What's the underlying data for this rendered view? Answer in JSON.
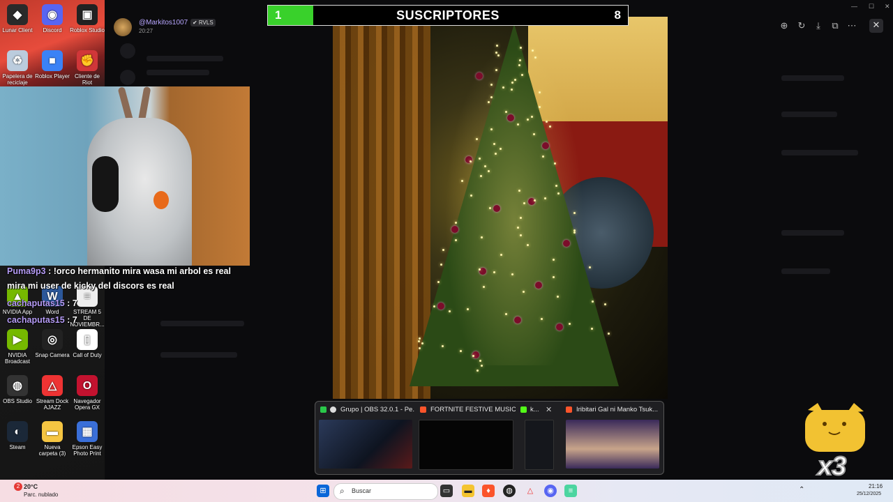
{
  "desktop_icons": [
    {
      "label": "Lunar Client",
      "glyph": "◆",
      "color": "#2a2a2a"
    },
    {
      "label": "Discord",
      "glyph": "◉",
      "color": "#5865f2"
    },
    {
      "label": "Roblox Studio",
      "glyph": "▣",
      "color": "#222"
    },
    {
      "label": "Papelera de reciclaje",
      "glyph": "♻",
      "color": "#bcd"
    },
    {
      "label": "Roblox Player",
      "glyph": "■",
      "color": "#3b82f6"
    },
    {
      "label": "Cliente de Riot",
      "glyph": "✊",
      "color": "#d13639"
    },
    {
      "label": "NVIDIA App",
      "glyph": "▲",
      "color": "#76b900"
    },
    {
      "label": "Word",
      "glyph": "W",
      "color": "#2b579a"
    },
    {
      "label": "STREAM 5 DE NOVIEMBR...",
      "glyph": "≡",
      "color": "#eee"
    },
    {
      "label": "NVIDIA Broadcast",
      "glyph": "▶",
      "color": "#76b900"
    },
    {
      "label": "Snap Camera",
      "glyph": "◎",
      "color": "#222"
    },
    {
      "label": "Call of Duty",
      "glyph": "▯",
      "color": "#fff"
    },
    {
      "label": "OBS Studio",
      "glyph": "◍",
      "color": "#333"
    },
    {
      "label": "Stream Dock AJAZZ",
      "glyph": "△",
      "color": "#e33"
    },
    {
      "label": "Navegador Opera GX",
      "glyph": "O",
      "color": "#c3122f"
    },
    {
      "label": "Steam",
      "glyph": "◐",
      "color": "#1b2838"
    },
    {
      "label": "Nueva carpeta (3)",
      "glyph": "▬",
      "color": "#f5c542"
    },
    {
      "label": "Epson Easy Photo Print",
      "glyph": "▦",
      "color": "#3a6fd8"
    }
  ],
  "subscribers": {
    "current": "1",
    "title": "SUSCRIPTORES",
    "goal": "8",
    "progress": 0.125,
    "fill_color": "#39d12b"
  },
  "message": {
    "username": "@Markitos1007",
    "badge": "✔ RVLS",
    "time": "20:27"
  },
  "chat": [
    {
      "user": "Puma9p3",
      "sep": " : ",
      "text": "!orco hermanito mira wasa mi arbol es real"
    },
    {
      "user": "",
      "sep": "",
      "text": "mira mi user de kicky del discors es real"
    },
    {
      "user": "cachaputas15",
      "sep": " : ",
      "text": "7"
    },
    {
      "user": "cachaputas15",
      "sep": " : ",
      "text": "7"
    }
  ],
  "viewer_toolbar": [
    "zoom-in-icon",
    "rotate-icon",
    "download-icon",
    "open-external-icon",
    "more-icon",
    "close-icon"
  ],
  "window_controls": [
    "—",
    "☐",
    "✕"
  ],
  "previews": [
    {
      "title": "Grupo | OBS 32.0.1 - Pe...",
      "icon_color": "#2ac84a",
      "thumb_color": "#2b3a5a"
    },
    {
      "title": "FORTNITE FESTIVE MUSIC...",
      "icon_color": "#fb542b",
      "thumb_color": "#050505"
    },
    {
      "title": "k...",
      "icon_color": "#53fc18",
      "thumb_color": "#15171c"
    },
    {
      "title": "Iribitari Gal ni Manko Tsuk...",
      "icon_color": "#fb542b",
      "thumb_color": "#3a2a5a"
    }
  ],
  "taskbar": {
    "weather_temp": "20°C",
    "weather_desc": "Parc. nublado",
    "weather_badge": "2",
    "search_placeholder": "Buscar",
    "time": "21:16",
    "date": "25/12/2025"
  },
  "sticker_multiplier": "x3",
  "colors": {
    "accent": "#39d12b",
    "username": "#b8a6ff",
    "chat_user": "#b69cf6"
  }
}
